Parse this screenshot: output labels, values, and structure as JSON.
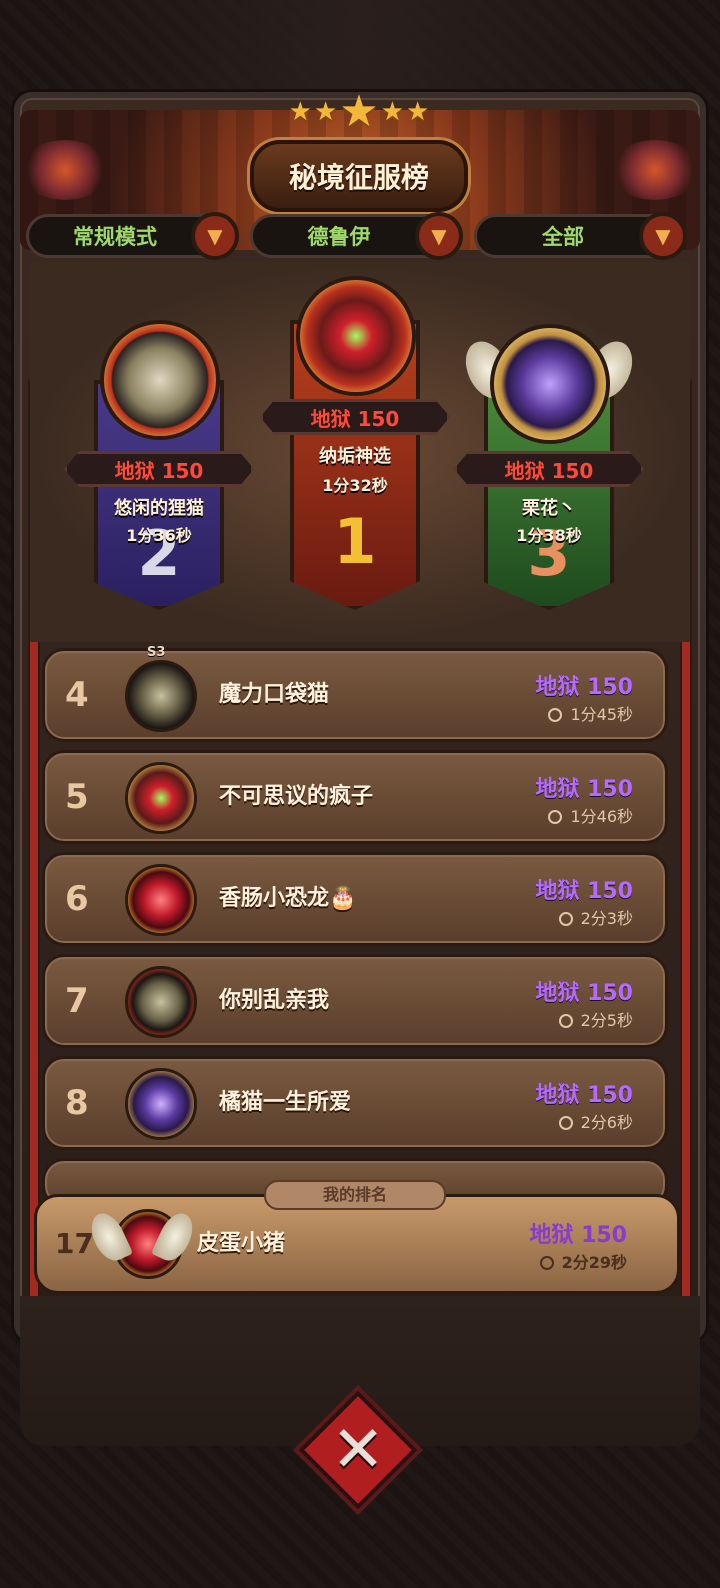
{
  "header": {
    "title": "秘境征服榜"
  },
  "filters": [
    {
      "label": "常规模式"
    },
    {
      "label": "德鲁伊"
    },
    {
      "label": "全部"
    }
  ],
  "podium": [
    {
      "place": "2",
      "score": "地狱 150",
      "name": "悠闲的狸猫",
      "time": "1分36秒"
    },
    {
      "place": "1",
      "score": "地狱 150",
      "name": "纳垢神选",
      "time": "1分32秒"
    },
    {
      "place": "3",
      "score": "地狱 150",
      "name": "栗花丶",
      "time": "1分38秒"
    }
  ],
  "rows": [
    {
      "rank": "4",
      "name": "魔力口袋猫",
      "score": "地狱 150",
      "time": "1分45秒",
      "season": "S3"
    },
    {
      "rank": "5",
      "name": "不可思议的疯子",
      "score": "地狱 150",
      "time": "1分46秒"
    },
    {
      "rank": "6",
      "name": "香肠小恐龙🎂",
      "score": "地狱 150",
      "time": "2分3秒"
    },
    {
      "rank": "7",
      "name": "你别乱亲我",
      "score": "地狱 150",
      "time": "2分5秒"
    },
    {
      "rank": "8",
      "name": "橘猫一生所爱",
      "score": "地狱 150",
      "time": "2分6秒"
    }
  ],
  "my_rank": {
    "tag": "我的排名",
    "rank": "17",
    "name": "皮蛋小猪",
    "score": "地狱 150",
    "time": "2分29秒"
  },
  "close_button": {
    "icon": "close-icon"
  }
}
